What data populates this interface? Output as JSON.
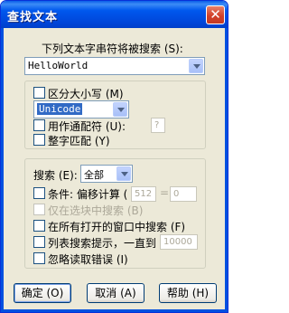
{
  "window": {
    "title": "查找文本",
    "close_glyph": "✕"
  },
  "search_text": {
    "label": "下列文本字串符将被搜索 (S):",
    "value": "HelloWorld"
  },
  "options": {
    "case_sensitive": "区分大小写 (M)",
    "encoding": "Unicode",
    "wildcard": "用作通配符 (U):",
    "wildcard_value": "?",
    "whole_word": "整字匹配 (Y)"
  },
  "scope": {
    "search_label": "搜索 (E):",
    "search_value": "全部",
    "condition_label": "条件: 偏移计算 (",
    "offset_a": "512",
    "equals": "=",
    "offset_b": "0",
    "selection_only": "仅在选块中搜索 (B)",
    "all_windows": "在所有打开的窗口中搜索 (F)",
    "list_hits": "列表搜索提示，一直到",
    "list_limit": "10000",
    "ignore_errors": "忽略读取错误 (I)"
  },
  "buttons": {
    "ok": "确定 (O)",
    "cancel": "取消 (A)",
    "help": "帮助 (H)"
  },
  "colors": {
    "titlebar": "#0054e3",
    "dialog_bg": "#ece9d8",
    "selection": "#316ac5"
  }
}
